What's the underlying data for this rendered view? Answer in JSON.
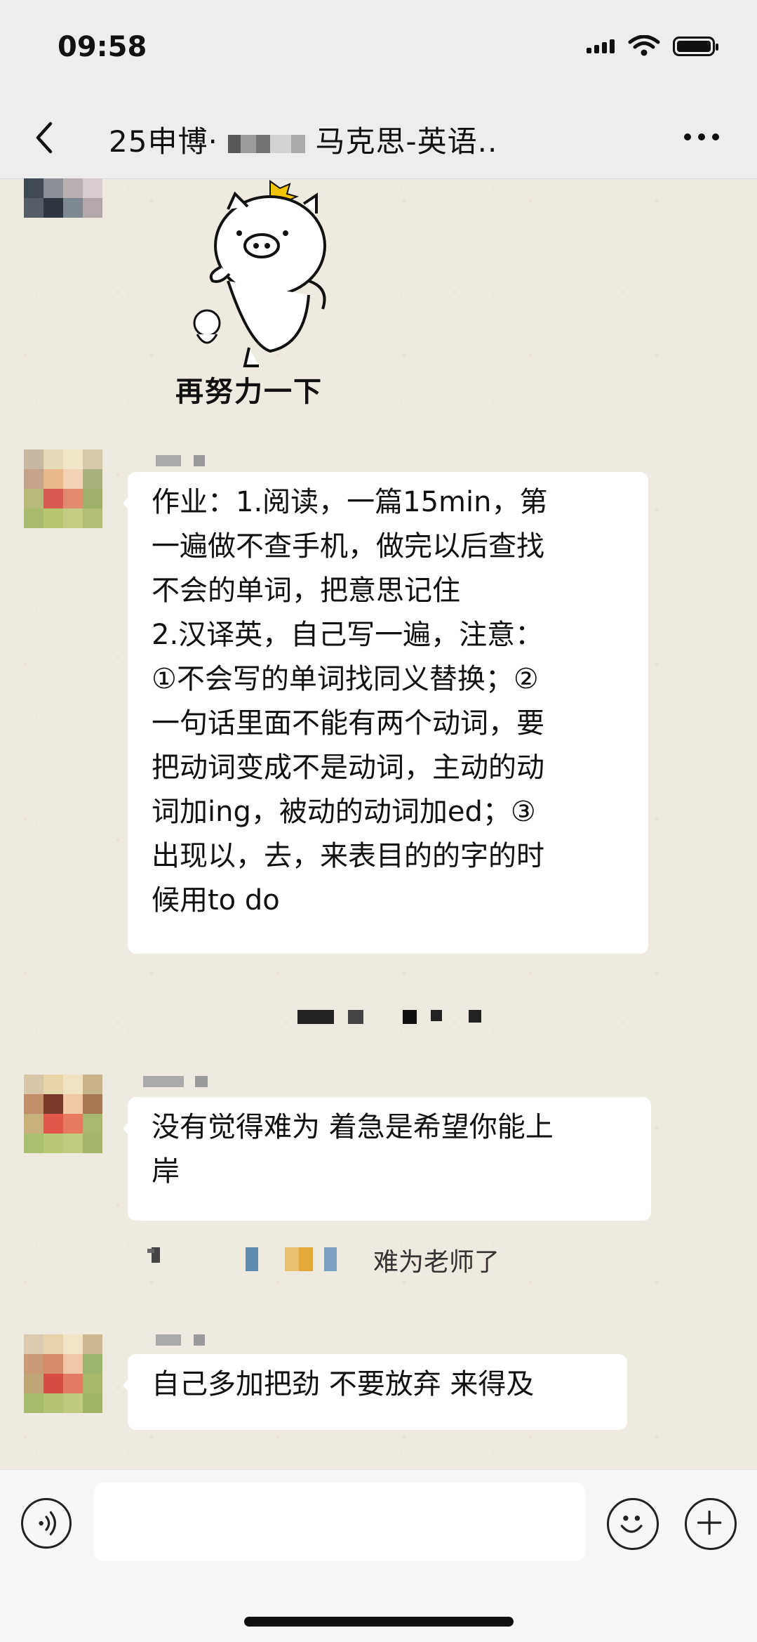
{
  "status": {
    "time": "09:58"
  },
  "header": {
    "title_prefix": "25申博·",
    "title_suffix": "马克思-英语.."
  },
  "sticker": {
    "caption": "再努力一下"
  },
  "messages": [
    {
      "lines": [
        "作业：1.阅读，一篇15min，第",
        "一遍做不查手机，做完以后查找",
        "不会的单词，把意思记住",
        "2.汉译英，自己写一遍，注意：",
        "①不会写的单词找同义替换；②",
        "一句话里面不能有两个动词，要",
        "把动词变成不是动词，主动的动",
        "词加ing，被动的动词加ed；③",
        "出现以，去，来表目的的字的时",
        "候用to do"
      ]
    },
    {
      "lines": [
        "没有觉得难为 着急是希望你能上",
        "岸"
      ]
    },
    {
      "lines": [
        "自己多加把劲 不要放弃 来得及"
      ]
    }
  ],
  "quote": {
    "text": "难为老师了"
  },
  "icons": {
    "back": "chevron-left-icon",
    "more": "more-dots-icon",
    "voice": "voice-icon",
    "emoji": "emoji-icon",
    "plus": "plus-icon"
  }
}
